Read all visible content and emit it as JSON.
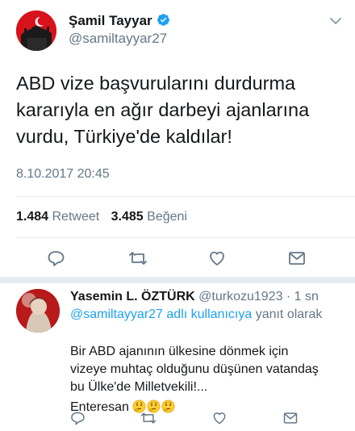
{
  "tweet": {
    "author_name": "Şamil Tayyar",
    "author_handle": "@samiltayyar27",
    "text_lines": [
      "ABD vize başvurularını durdurma",
      "kararıyla en ağır darbeyi ajanlarına",
      "vurdu, Türkiye'de kaldılar!"
    ],
    "timestamp": "8.10.2017 20:45",
    "retweet_count": "1.484",
    "retweet_label": "Retweet",
    "like_count": "3.485",
    "like_label": "Beğeni"
  },
  "reply": {
    "author_name": "Yasemin L. ÖZTÜRK",
    "meta": "@turkozu1923 · 1 sn",
    "reply_to_link": "@samiltayyar27 adlı kullanıcıya",
    "reply_to_suffix": "yanıt olarak",
    "text_lines": [
      "Bir ABD ajanının ülkesine dönmek için",
      "vizeye muhtaç olduğunu düşünen vatandaş",
      "bu Ülke'de Milletvekili!..."
    ],
    "last_line": "Enteresan",
    "emoji_count": 3
  },
  "icons": {
    "verified": "verified-badge-icon",
    "chevron": "chevron-down-icon",
    "reply": "reply-icon",
    "retweet": "retweet-icon",
    "like": "heart-icon",
    "dm": "envelope-icon",
    "emoji": "thinking-face-emoji"
  },
  "colors": {
    "accent": "#1da1f2",
    "secondary_text": "#657786",
    "divider": "#e1e8ed"
  }
}
